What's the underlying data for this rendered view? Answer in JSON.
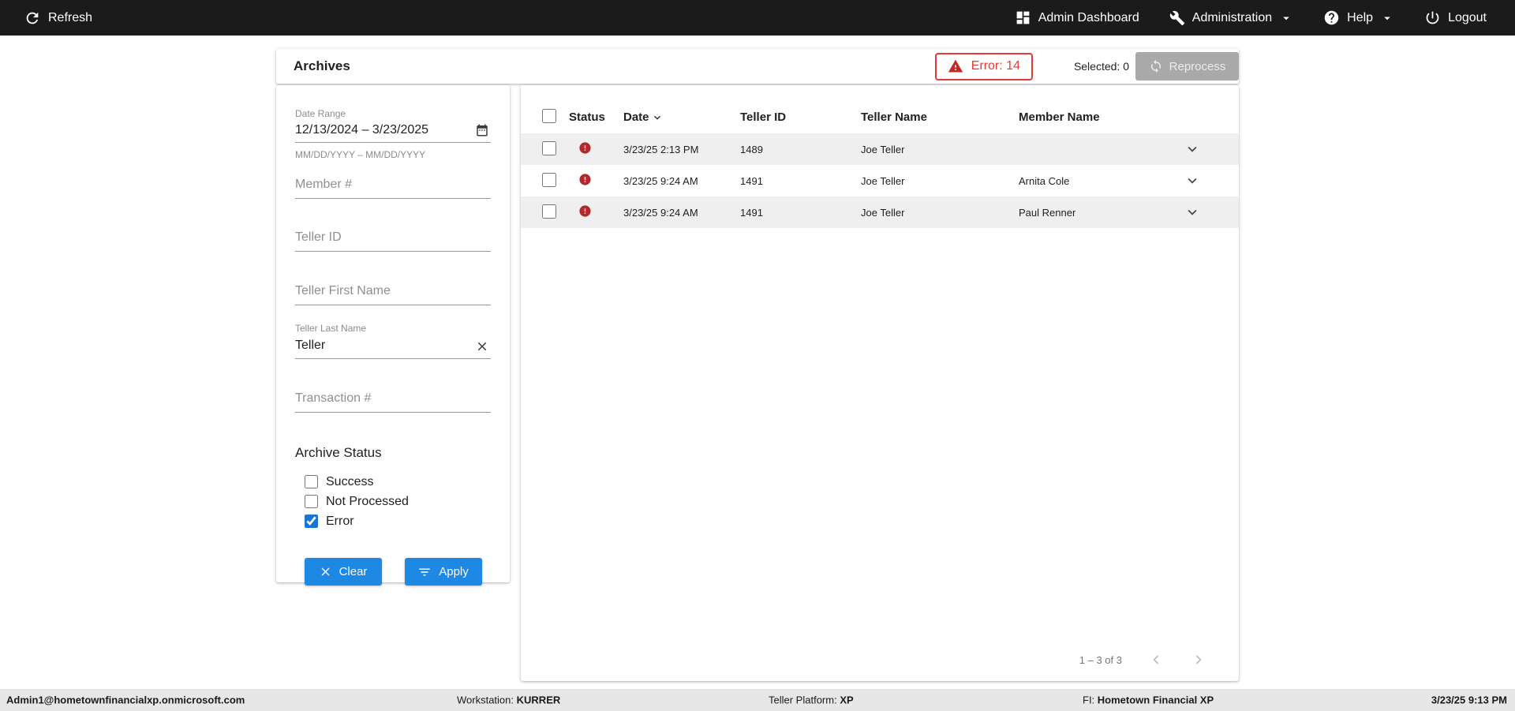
{
  "topbar": {
    "refresh": "Refresh",
    "admin_dashboard": "Admin Dashboard",
    "administration": "Administration",
    "help": "Help",
    "logout": "Logout"
  },
  "header": {
    "title": "Archives",
    "error_badge": "Error: 14",
    "selected": "Selected: 0",
    "reprocess": "Reprocess"
  },
  "filters": {
    "date_range": {
      "label": "Date Range",
      "value": "12/13/2024 – 3/23/2025",
      "hint": "MM/DD/YYYY – MM/DD/YYYY"
    },
    "member_number_placeholder": "Member #",
    "teller_id_placeholder": "Teller ID",
    "teller_first_name_placeholder": "Teller First Name",
    "teller_last_name": {
      "label": "Teller Last Name",
      "value": "Teller"
    },
    "transaction_number_placeholder": "Transaction #",
    "archive_status": {
      "label": "Archive Status",
      "options": [
        {
          "label": "Success",
          "checked": false
        },
        {
          "label": "Not Processed",
          "checked": false
        },
        {
          "label": "Error",
          "checked": true
        }
      ]
    },
    "clear": "Clear",
    "apply": "Apply"
  },
  "table": {
    "columns": [
      "Status",
      "Date",
      "Teller ID",
      "Teller Name",
      "Member Name"
    ],
    "sorted_by": "Date",
    "rows": [
      {
        "status": "error",
        "date": "3/23/25 2:13 PM",
        "teller_id": "1489",
        "teller_name": "Joe Teller",
        "member_name": ""
      },
      {
        "status": "error",
        "date": "3/23/25 9:24 AM",
        "teller_id": "1491",
        "teller_name": "Joe Teller",
        "member_name": "Arnita Cole"
      },
      {
        "status": "error",
        "date": "3/23/25 9:24 AM",
        "teller_id": "1491",
        "teller_name": "Joe Teller",
        "member_name": "Paul Renner"
      }
    ],
    "pagination": "1 – 3 of 3"
  },
  "statusbar": {
    "user": "Admin1@hometownfinancialxp.onmicrosoft.com",
    "workstation": {
      "label": "Workstation:",
      "value": "KURRER"
    },
    "teller_platform": {
      "label": "Teller Platform:",
      "value": "XP"
    },
    "fi": {
      "label": "FI:",
      "value": "Hometown Financial XP"
    },
    "datetime": "3/23/25 9:13 PM"
  },
  "colors": {
    "topbar_bg": "#1b1b1b",
    "accent_blue": "#1e88e5",
    "error_red": "#e53935",
    "status_error_red": "#b3282d",
    "row_shade": "#efefef"
  }
}
